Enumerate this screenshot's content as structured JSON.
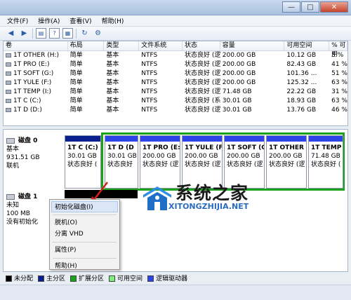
{
  "menubar": {
    "items": [
      "文件(F)",
      "操作(A)",
      "查看(V)",
      "帮助(H)"
    ]
  },
  "toolbar": {
    "icons": [
      "back-arrow-icon",
      "forward-arrow-icon",
      "properties-icon",
      "help-icon",
      "disk-list-icon",
      "refresh-icon",
      "settings-icon"
    ]
  },
  "volume_table": {
    "headers": [
      "卷",
      "布局",
      "类型",
      "文件系统",
      "状态",
      "容量",
      "可用空间",
      "% 可用"
    ],
    "rows": [
      [
        "1T OTHER (H:)",
        "简单",
        "基本",
        "NTFS",
        "状态良好 (逻...",
        "200.00 GB",
        "10.12 GB",
        "5 %"
      ],
      [
        "1T PRO (E:)",
        "简单",
        "基本",
        "NTFS",
        "状态良好 (逻...",
        "200.00 GB",
        "82.43 GB",
        "41 %"
      ],
      [
        "1T SOFT (G:)",
        "简单",
        "基本",
        "NTFS",
        "状态良好 (逻...",
        "200.00 GB",
        "101.36 ...",
        "51 %"
      ],
      [
        "1T YULE (F:)",
        "简单",
        "基本",
        "NTFS",
        "状态良好 (逻...",
        "200.00 GB",
        "125.32 ...",
        "63 %"
      ],
      [
        "1T TEMP (I:)",
        "简单",
        "基本",
        "NTFS",
        "状态良好 (逻...",
        "71.48 GB",
        "22.22 GB",
        "31 %"
      ],
      [
        "1T C (C:)",
        "简单",
        "基本",
        "NTFS",
        "状态良好 (系...",
        "30.01 GB",
        "18.93 GB",
        "63 %"
      ],
      [
        "1T D (D:)",
        "简单",
        "基本",
        "NTFS",
        "状态良好 (逻...",
        "30.01 GB",
        "13.76 GB",
        "46 %"
      ]
    ]
  },
  "disk0": {
    "name": "磁盘 0",
    "type": "基本",
    "size": "931.51 GB",
    "status": "联机",
    "partitions": [
      {
        "title": "1T C (C:)",
        "size": "30.01 GB",
        "status": "状态良好 (",
        "kind": "primary"
      },
      {
        "title": "1T D (D",
        "size": "30.01 GB",
        "status": "状态良好",
        "kind": "logical"
      },
      {
        "title": "1T PRO (E:",
        "size": "200.00 GB",
        "status": "状态良好 (逻",
        "kind": "logical"
      },
      {
        "title": "1T YULE (F",
        "size": "200.00 GB",
        "status": "状态良好 (逻",
        "kind": "logical"
      },
      {
        "title": "1T SOFT (G",
        "size": "200.00 GB",
        "status": "状态良好 (逻",
        "kind": "logical"
      },
      {
        "title": "1T OTHER",
        "size": "200.00 GB",
        "status": "状态良好 (逻",
        "kind": "logical"
      },
      {
        "title": "1T TEMP",
        "size": "71.48 GB",
        "status": "状态良好 (",
        "kind": "logical"
      }
    ]
  },
  "disk1": {
    "name": "磁盘 1",
    "type": "未知",
    "size": "100 MB",
    "status": "没有初始化"
  },
  "context_menu": {
    "init_disk": "初始化磁盘(I)",
    "offline": "脱机(O)",
    "detach_vhd": "分离 VHD",
    "properties": "属性(P)",
    "help": "帮助(H)"
  },
  "watermark": {
    "name": "系统之家",
    "url": "XITONGZHIJIA.NET"
  },
  "legend": {
    "items": [
      {
        "label": "未分配",
        "color": "#000000"
      },
      {
        "label": "主分区",
        "color": "#0a1f8f"
      },
      {
        "label": "扩展分区",
        "color": "#1aa31a"
      },
      {
        "label": "可用空间",
        "color": "#7cf07c"
      },
      {
        "label": "逻辑驱动器",
        "color": "#2d45e8"
      }
    ]
  }
}
